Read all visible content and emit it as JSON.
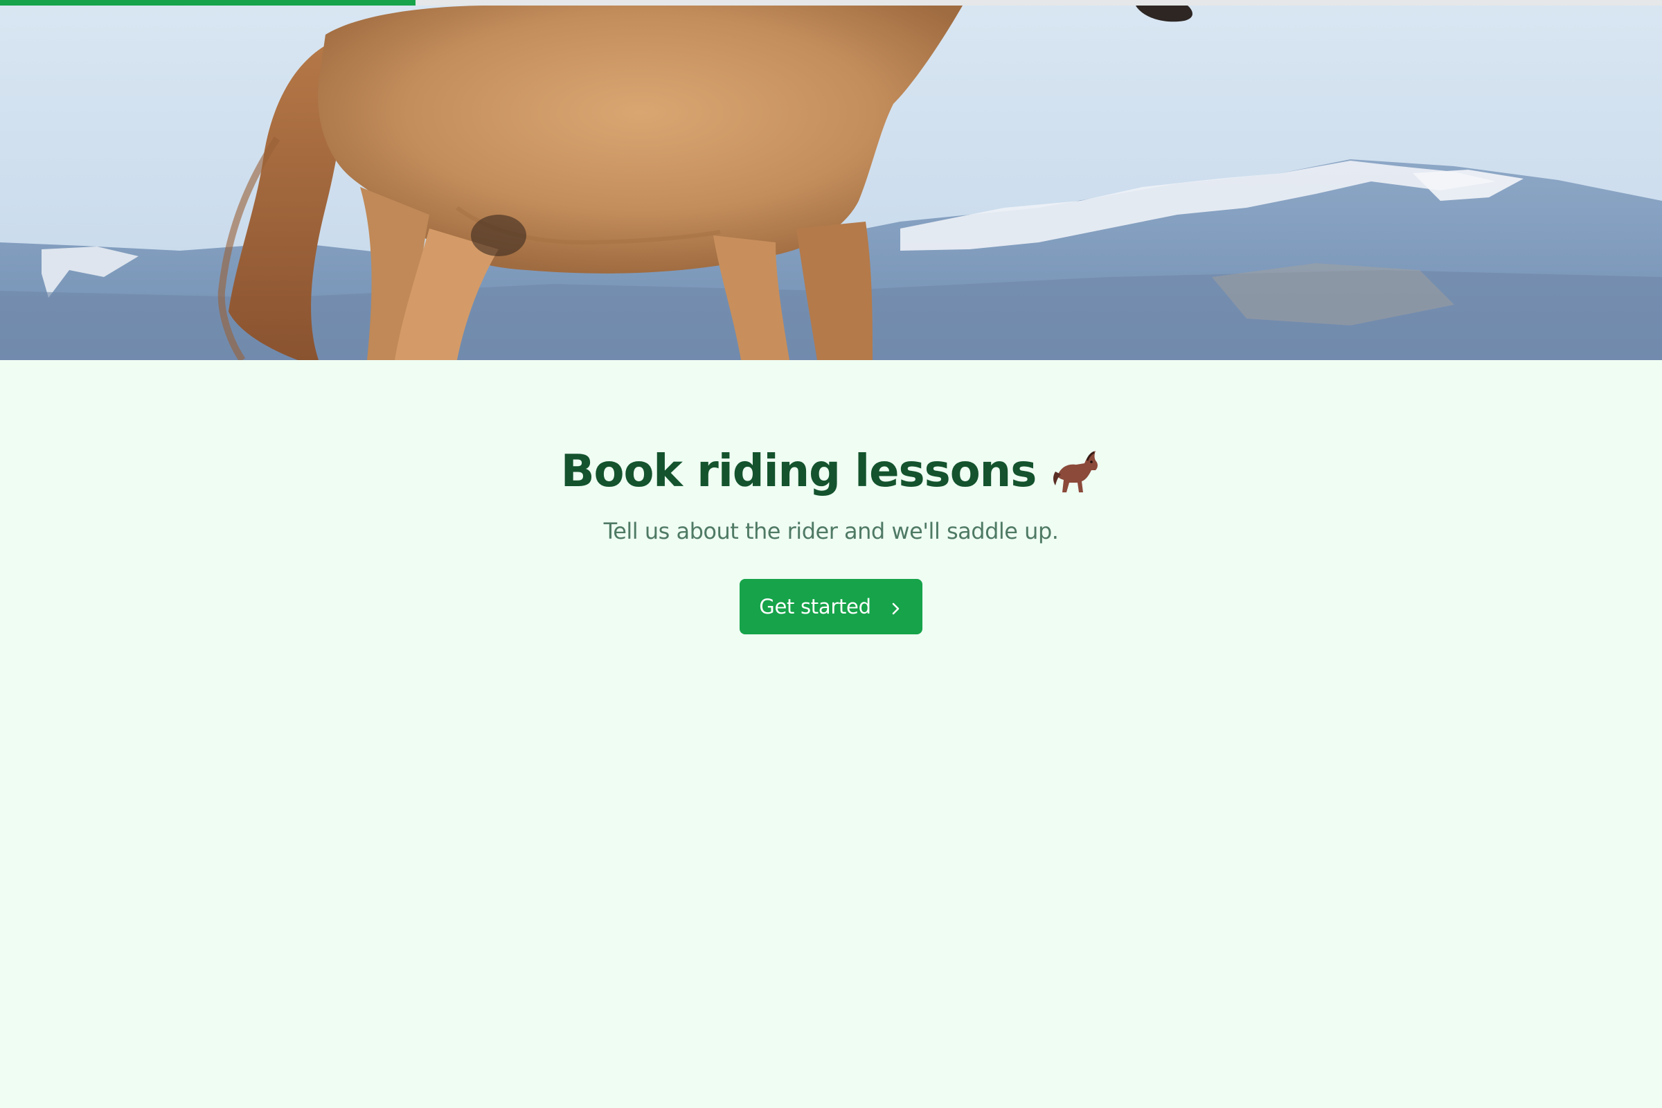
{
  "progress": {
    "fraction": 0.25,
    "color": "#16a34a",
    "track_color": "#e5e7e8"
  },
  "hero": {
    "image": "horse-in-front-of-snowy-mountains"
  },
  "heading": {
    "title": "Book riding lessons",
    "emoji_icon": "horse-racing-icon"
  },
  "subtitle": "Tell us about the rider and we'll saddle up.",
  "cta": {
    "label": "Get started",
    "icon": "chevron-right-icon",
    "color": "#16a34a"
  },
  "colors": {
    "background": "#effdf3",
    "title": "#14532d",
    "subtitle": "#4f7a64"
  }
}
